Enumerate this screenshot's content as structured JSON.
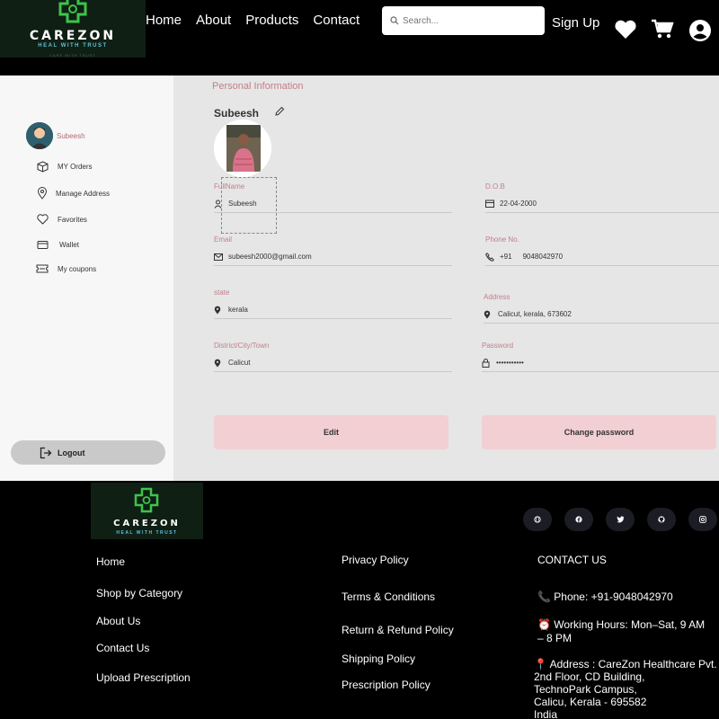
{
  "nav": {
    "logo": {
      "brand": "CAREZON",
      "tagline": "HEAL WITH TRUST",
      "subtagline": "CARE WITH TRUST"
    },
    "links": [
      "Home",
      "About",
      "Products",
      "Contact"
    ],
    "search_placeholder": "Search...",
    "signup_label": "Sign Up",
    "icons": [
      "search-icon",
      "heart-icon",
      "cart-icon",
      "account-icon"
    ]
  },
  "sidebar": {
    "user_name": "Subeesh",
    "items": [
      {
        "label": "MY Orders",
        "icon": "box-icon"
      },
      {
        "label": "Manage Address",
        "icon": "location-pin-icon"
      },
      {
        "label": "Favorites",
        "icon": "heart-outline-icon"
      },
      {
        "label": "Wallet",
        "icon": "wallet-icon"
      },
      {
        "label": "My coupons",
        "icon": "coupon-icon"
      }
    ],
    "logout_label": "Logout"
  },
  "profile": {
    "section_title": "Personal Information",
    "name": "Subeesh",
    "fields": {
      "full_name": {
        "label": "FullName",
        "value": "Subeesh"
      },
      "dob": {
        "label": "D.O.B",
        "value": "22-04-2000"
      },
      "email": {
        "label": "Email",
        "value": "subeesh2000@gmail.com"
      },
      "phone": {
        "label": "Phone No.",
        "code": "+91",
        "value": "9048042970"
      },
      "state": {
        "label": "state",
        "value": "kerala"
      },
      "address": {
        "label": "Address",
        "value": "Calicut, kerala, 673602"
      },
      "district": {
        "label": "District/City/Town",
        "value": "Calicut"
      },
      "password": {
        "label": "Password",
        "value": "•••••••••••"
      }
    },
    "edit_label": "Edit",
    "change_password_label": "Change password"
  },
  "footer": {
    "logo": {
      "brand": "CAREZON",
      "tagline": "HEAL WITH TRUST"
    },
    "col1": [
      "Home",
      "Shop by Category",
      "About Us",
      "Contact Us",
      "Upload Prescription"
    ],
    "col2": [
      "Privacy Policy",
      "Terms & Conditions",
      "Return & Refund Policy",
      "Shipping Policy",
      "Prescription Policy"
    ],
    "contact_title": "CONTACT US",
    "phone": "📞 Phone: +91-9048042970",
    "hours_line1": "⏰ Working Hours: Mon–Sat, 9 AM",
    "hours_line2": "– 8 PM",
    "address_lines": [
      "📍 Address : CareZon Healthcare Pvt.",
      "2nd Floor, CD Building,",
      "TechnoPark Campus,",
      "Calicu, Kerala - 695582",
      "India"
    ],
    "social_icons": [
      "globe-icon",
      "facebook-icon",
      "twitter-icon",
      "github-icon",
      "instagram-icon"
    ]
  },
  "colors": {
    "accent": "#c27f8a",
    "button_bg": "#f2cfd2",
    "logo_green": "#3ec44a",
    "tagline_blue": "#5fc3d9"
  }
}
